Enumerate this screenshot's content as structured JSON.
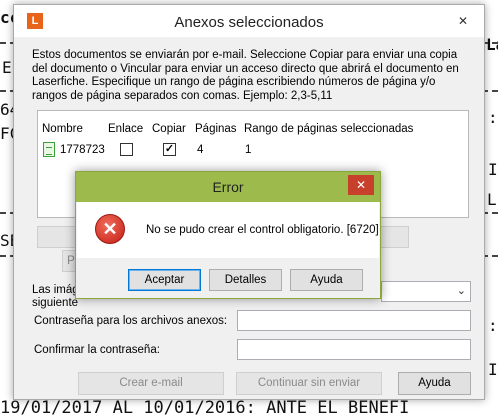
{
  "background_doc": {
    "fragments": [
      {
        "text": "cc"
      },
      {
        "text": "E"
      },
      {
        "text": "64"
      },
      {
        "text": "FC"
      },
      {
        "text": "SE"
      },
      {
        "text": "La"
      },
      {
        "text": ":"
      },
      {
        "text": "L"
      },
      {
        "text": ":"
      },
      {
        "text": "I"
      },
      {
        "text": "II"
      },
      {
        "text": "19/01/2017  AL 10/01/2016: ANTE EL BENEFI"
      }
    ]
  },
  "window": {
    "title": "Anexos seleccionados",
    "app_icon": "L",
    "close_icon": "✕",
    "intro": "Estos documentos se enviarán por e-mail. Seleccione Copiar para enviar una copia del documento o Vincular para enviar un acceso directo que abrirá el documento en Laserfiche. Especifique un rango de página escribiendo números de página y/o rangos de página separados con comas. Ejemplo: 2,3-5,11",
    "table": {
      "columns": [
        "Nombre",
        "Enlace",
        "Copiar",
        "Páginas",
        "Rango de páginas seleccionadas"
      ],
      "rows": [
        {
          "name": "1778723",
          "enlace": false,
          "copiar": true,
          "paginas": "4",
          "rango": "1"
        }
      ]
    },
    "partial_label_1": "Las imág",
    "partial_label_2": "siguiente",
    "partial_button": "P",
    "password_label": "Contraseña para los archivos anexos:",
    "confirm_label": "Confirmar la contraseña:",
    "buttons": {
      "create_email": "Crear e-mail",
      "continue_without": "Continuar sin enviar",
      "help": "Ayuda"
    }
  },
  "error_dialog": {
    "title": "Error",
    "close_icon": "✕",
    "icon": "error-icon",
    "icon_glyph": "✕",
    "message": "No se pudo crear el control obligatorio. [6720]",
    "buttons": {
      "accept": "Aceptar",
      "details": "Detalles",
      "help": "Ayuda"
    }
  },
  "colors": {
    "accent": "#e8641b",
    "error_title": "#9cbb4c",
    "close_red": "#c7402c"
  }
}
